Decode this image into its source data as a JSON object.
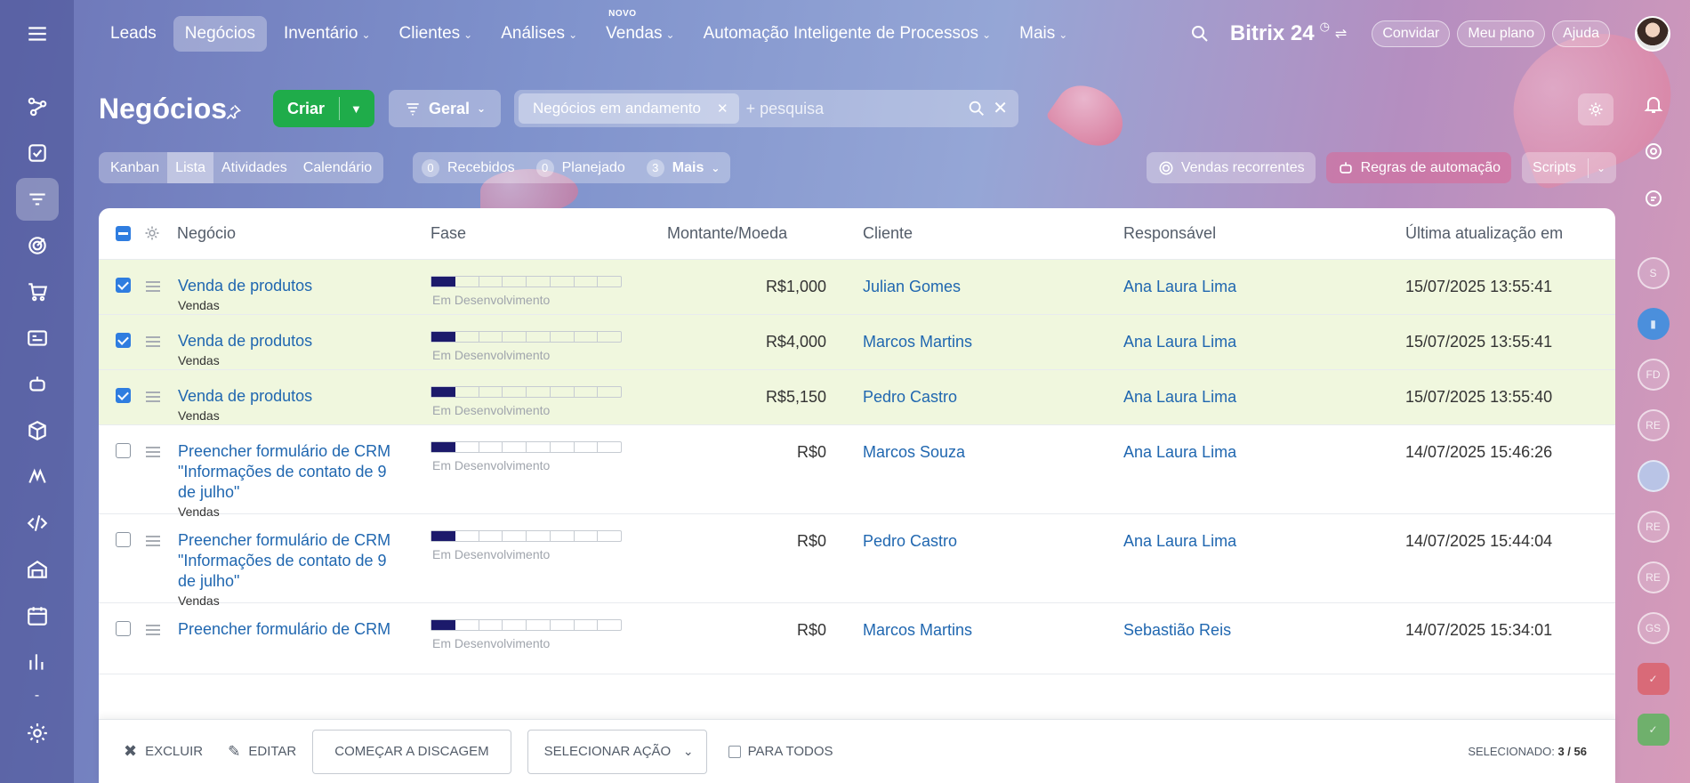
{
  "topnav": {
    "items": [
      {
        "label": "Leads",
        "chevron": false,
        "active": false,
        "badge": ""
      },
      {
        "label": "Negócios",
        "chevron": false,
        "active": true,
        "badge": ""
      },
      {
        "label": "Inventário",
        "chevron": true,
        "active": false,
        "badge": ""
      },
      {
        "label": "Clientes",
        "chevron": true,
        "active": false,
        "badge": ""
      },
      {
        "label": "Análises",
        "chevron": true,
        "active": false,
        "badge": ""
      },
      {
        "label": "Vendas",
        "chevron": true,
        "active": false,
        "badge": "NOVO"
      },
      {
        "label": "Automação Inteligente de Processos",
        "chevron": true,
        "active": false,
        "badge": ""
      },
      {
        "label": "Mais",
        "chevron": true,
        "active": false,
        "badge": ""
      }
    ],
    "brand": "Bitrix 24",
    "invite_label": "Convidar",
    "plan_label": "Meu plano",
    "help_label": "Ajuda"
  },
  "page": {
    "title": "Negócios",
    "create_label": "Criar",
    "general_label": "Geral",
    "filter_chip": "Negócios em andamento",
    "search_placeholder": "+ pesquisa"
  },
  "views": {
    "tabs": [
      {
        "label": "Kanban",
        "active": false
      },
      {
        "label": "Lista",
        "active": true
      },
      {
        "label": "Atividades",
        "active": false
      },
      {
        "label": "Calendário",
        "active": false
      }
    ],
    "counters": [
      {
        "count": "0",
        "label": "Recebidos"
      },
      {
        "count": "0",
        "label": "Planejado"
      },
      {
        "count": "3",
        "label": "Mais"
      }
    ],
    "recurring_label": "Vendas recorrentes",
    "automation_label": "Regras de automação",
    "scripts_label": "Scripts"
  },
  "rail": {
    "avatars": [
      "S",
      "",
      "FD",
      "RE",
      "",
      "RE",
      "RE",
      "GS",
      "",
      ""
    ]
  },
  "grid": {
    "columns": {
      "deal": "Negócio",
      "stage": "Fase",
      "amount": "Montante/Moeda",
      "client": "Cliente",
      "responsible": "Responsável",
      "updated": "Última atualização em"
    },
    "rows": [
      {
        "title": "Venda de produtos",
        "category": "Vendas",
        "stage": "Em Desenvolvimento",
        "stage_progress": 1,
        "amount": "R$1,000",
        "client": "Julian Gomes",
        "responsible": "Ana Laura Lima",
        "updated": "15/07/2025 13:55:41",
        "selected": true
      },
      {
        "title": "Venda de produtos",
        "category": "Vendas",
        "stage": "Em Desenvolvimento",
        "stage_progress": 1,
        "amount": "R$4,000",
        "client": "Marcos Martins",
        "responsible": "Ana Laura Lima",
        "updated": "15/07/2025 13:55:41",
        "selected": true
      },
      {
        "title": "Venda de produtos",
        "category": "Vendas",
        "stage": "Em Desenvolvimento",
        "stage_progress": 1,
        "amount": "R$5,150",
        "client": "Pedro Castro",
        "responsible": "Ana Laura Lima",
        "updated": "15/07/2025 13:55:40",
        "selected": true
      },
      {
        "title": "Preencher formulário de CRM \"Informações de contato de 9 de julho\"",
        "category": "Vendas",
        "stage": "Em Desenvolvimento",
        "stage_progress": 1,
        "amount": "R$0",
        "client": "Marcos Souza",
        "responsible": "Ana Laura Lima",
        "updated": "14/07/2025 15:46:26",
        "selected": false
      },
      {
        "title": "Preencher formulário de CRM \"Informações de contato de 9 de julho\"",
        "category": "Vendas",
        "stage": "Em Desenvolvimento",
        "stage_progress": 1,
        "amount": "R$0",
        "client": "Pedro Castro",
        "responsible": "Ana Laura Lima",
        "updated": "14/07/2025 15:44:04",
        "selected": false
      },
      {
        "title": "Preencher formulário de CRM",
        "category": "",
        "stage": "Em Desenvolvimento",
        "stage_progress": 1,
        "amount": "R$0",
        "client": "Marcos Martins",
        "responsible": "Sebastião Reis",
        "updated": "14/07/2025 15:34:01",
        "selected": false
      }
    ]
  },
  "actionbar": {
    "delete_label": "Excluir",
    "edit_label": "Editar",
    "dial_label": "Começar a discagem",
    "select_action_label": "Selecionar ação",
    "for_all_label": "Para todos",
    "selected_label": "Selecionado:",
    "selected_value": "3 / 56"
  }
}
